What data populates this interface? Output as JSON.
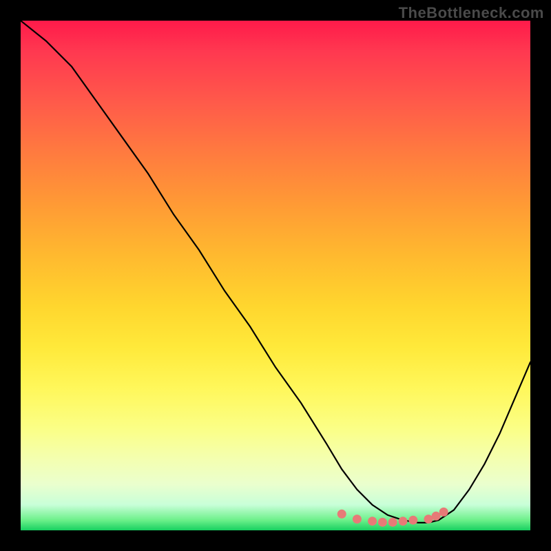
{
  "watermark": "TheBottleneck.com",
  "chart_data": {
    "type": "line",
    "title": "",
    "xlabel": "",
    "ylabel": "",
    "xlim": [
      0,
      100
    ],
    "ylim": [
      0,
      100
    ],
    "x": [
      0,
      5,
      10,
      15,
      20,
      25,
      30,
      35,
      40,
      45,
      50,
      55,
      60,
      63,
      66,
      69,
      72,
      75,
      78,
      80,
      82,
      85,
      88,
      91,
      94,
      97,
      100
    ],
    "y": [
      100,
      96,
      91,
      84,
      77,
      70,
      62,
      55,
      47,
      40,
      32,
      25,
      17,
      12,
      8,
      5,
      3,
      2,
      1.5,
      1.5,
      2,
      4,
      8,
      13,
      19,
      26,
      33
    ],
    "markers": {
      "color": "#e77a77",
      "points": [
        {
          "x": 63,
          "y": 3.2
        },
        {
          "x": 66,
          "y": 2.2
        },
        {
          "x": 69,
          "y": 1.8
        },
        {
          "x": 71,
          "y": 1.6
        },
        {
          "x": 73,
          "y": 1.6
        },
        {
          "x": 75,
          "y": 1.8
        },
        {
          "x": 77,
          "y": 2.0
        },
        {
          "x": 80,
          "y": 2.2
        },
        {
          "x": 81.5,
          "y": 2.8
        },
        {
          "x": 83,
          "y": 3.6
        }
      ]
    },
    "background": "rainbow-gradient-green-bottom-red-top"
  }
}
